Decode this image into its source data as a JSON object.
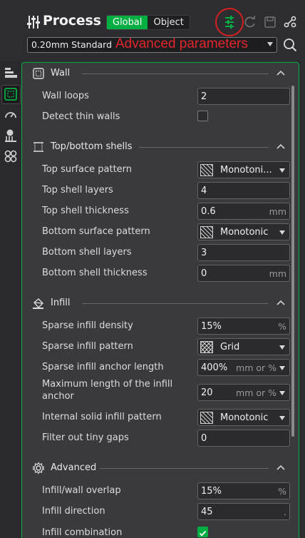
{
  "header": {
    "title": "Process",
    "toggle": {
      "global": "Global",
      "object": "Object"
    },
    "icons": [
      "advanced-params-icon",
      "reset-icon",
      "save-icon",
      "compare-icon"
    ]
  },
  "preset": {
    "value": "0.20mm Standard",
    "annotation": "Advanced parameters"
  },
  "sidebar": {
    "icons": [
      "quality-icon",
      "strength-icon",
      "speed-icon",
      "support-icon",
      "others-icon"
    ]
  },
  "sections": {
    "wall": {
      "title": "Wall",
      "wall_loops": {
        "label": "Wall loops",
        "value": "2"
      },
      "detect_thin": {
        "label": "Detect thin walls",
        "checked": false
      }
    },
    "shells": {
      "title": "Top/bottom shells",
      "top_pattern": {
        "label": "Top surface pattern",
        "value": "Monotoni..."
      },
      "top_layers": {
        "label": "Top shell layers",
        "value": "4"
      },
      "top_thickness": {
        "label": "Top shell thickness",
        "value": "0.6",
        "unit": "mm"
      },
      "bottom_pattern": {
        "label": "Bottom surface pattern",
        "value": "Monotonic"
      },
      "bottom_layers": {
        "label": "Bottom shell layers",
        "value": "3"
      },
      "bottom_thickness": {
        "label": "Bottom shell thickness",
        "value": "0",
        "unit": "mm"
      }
    },
    "infill": {
      "title": "Infill",
      "density": {
        "label": "Sparse infill density",
        "value": "15%",
        "unit": "%"
      },
      "pattern": {
        "label": "Sparse infill pattern",
        "value": "Grid"
      },
      "anchor": {
        "label": "Sparse infill anchor length",
        "value": "400%",
        "unit": "mm or %"
      },
      "anchor_max": {
        "label": "Maximum length of the infill anchor",
        "value": "20",
        "unit": "mm or %"
      },
      "solid_pattern": {
        "label": "Internal solid infill pattern",
        "value": "Monotonic"
      },
      "filter_gaps": {
        "label": "Filter out tiny gaps",
        "value": "0"
      }
    },
    "advanced": {
      "title": "Advanced",
      "overlap": {
        "label": "Infill/wall overlap",
        "value": "15%",
        "unit": "%"
      },
      "direction": {
        "label": "Infill direction",
        "value": "45",
        "unit": "."
      },
      "combination": {
        "label": "Infill combination",
        "checked": true
      }
    }
  },
  "colors": {
    "accent": "#00ae42",
    "annotation": "#e0262b",
    "panel": "#3a3a3e",
    "background": "#2d2d31"
  }
}
